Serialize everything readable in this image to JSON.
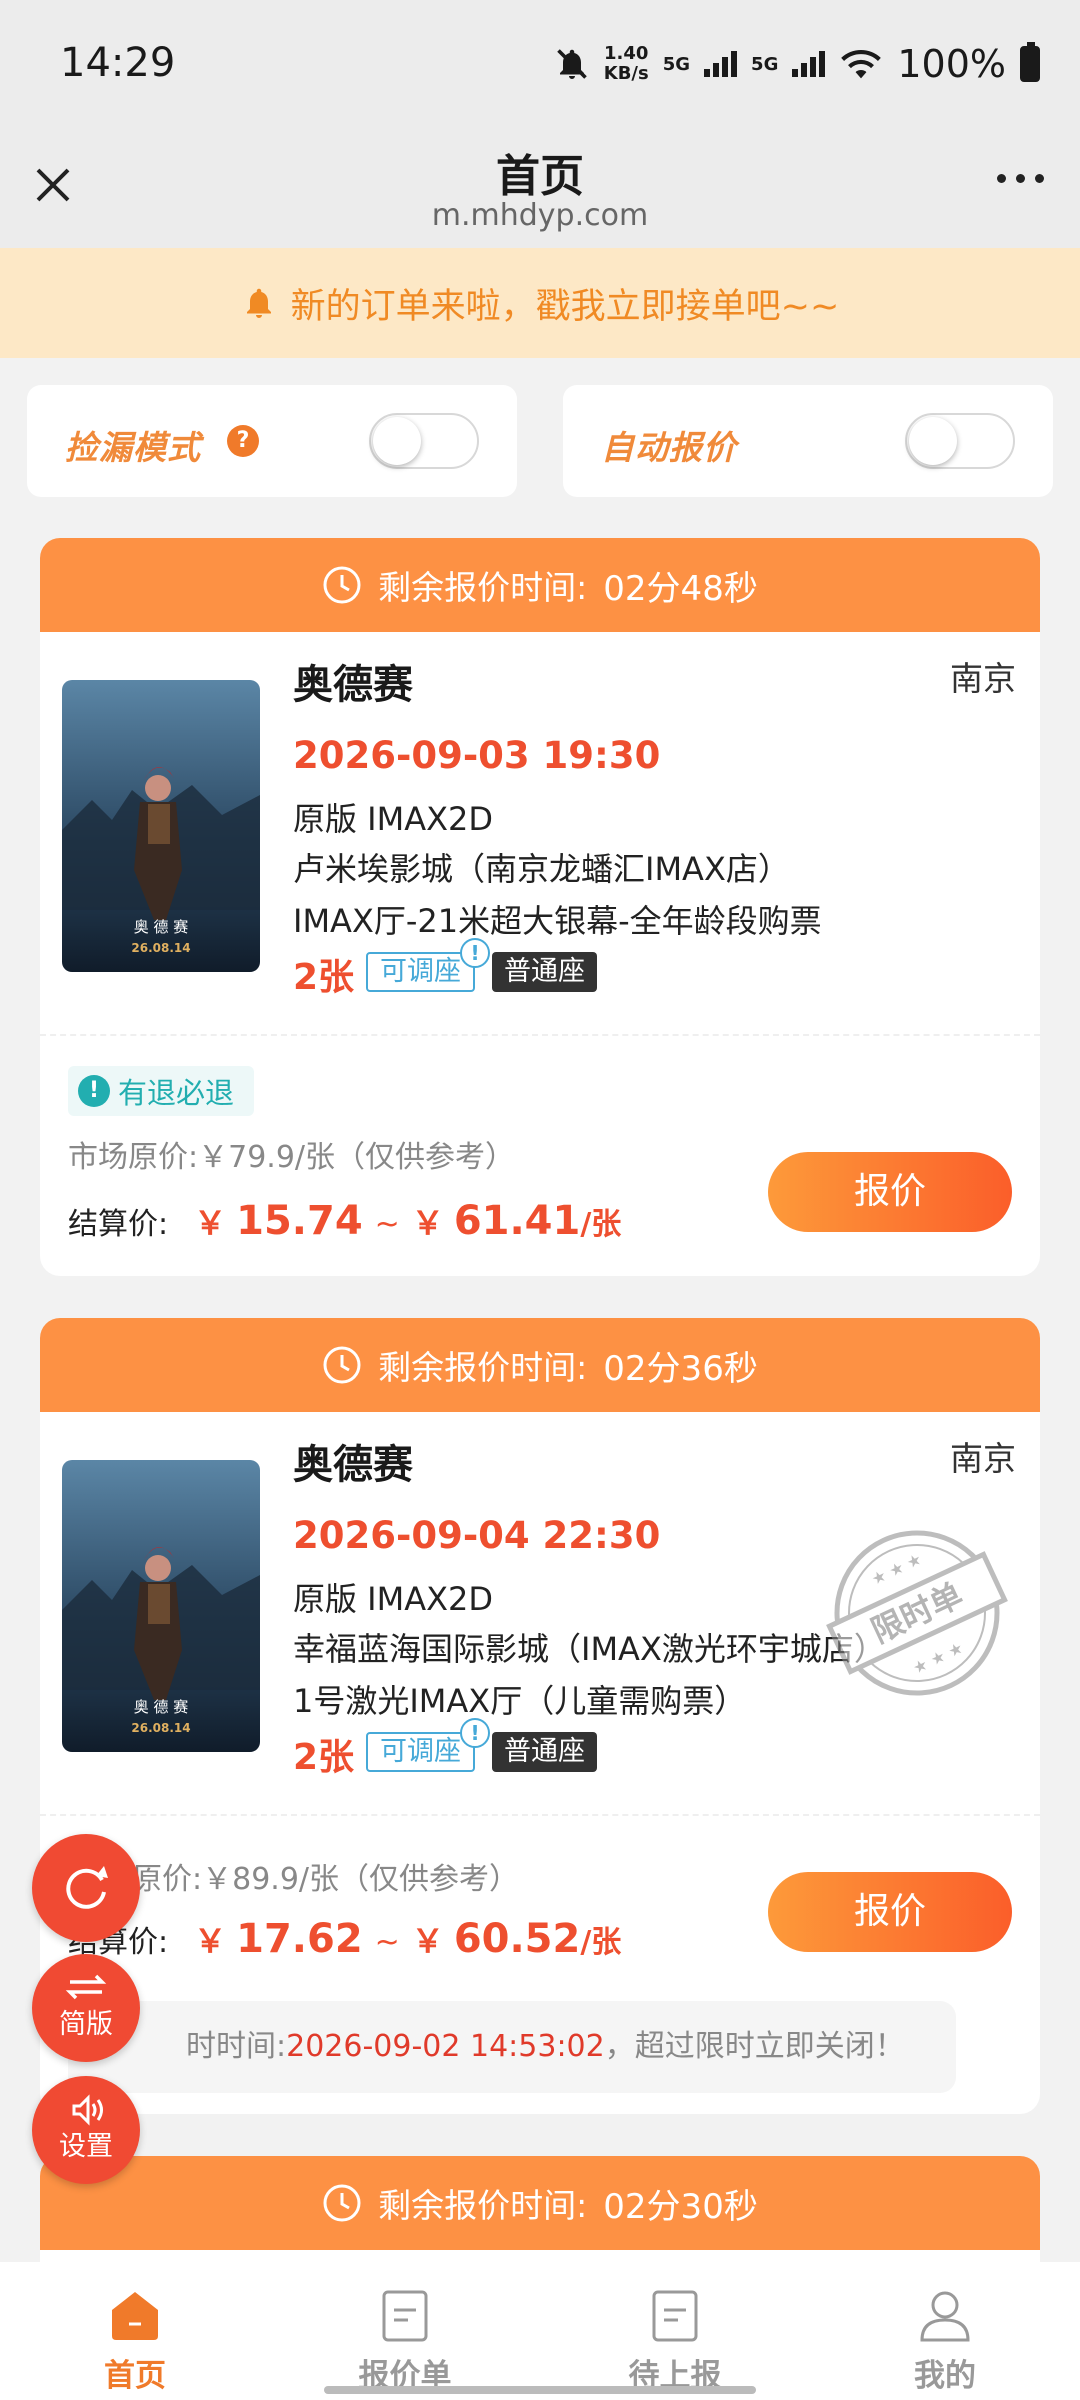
{
  "status_bar": {
    "time": "14:29",
    "net_speed_value": "1.40",
    "net_speed_unit": "KB/s",
    "signal1": "5G",
    "signal2": "5G",
    "battery": "100%"
  },
  "nav": {
    "title": "首页",
    "url": "m.mhdyp.com"
  },
  "notice": {
    "text": "新的订单来啦，戳我立即接单吧~~"
  },
  "toggles": {
    "pickup_mode_label": "捡漏模式",
    "pickup_mode_help": "?",
    "pickup_mode_on": false,
    "auto_quote_label": "自动报价",
    "auto_quote_on": false
  },
  "orders": [
    {
      "countdown_label": "剩余报价时间:",
      "countdown_value": "02分48秒",
      "title": "奥德赛",
      "city": "南京",
      "showtime": "2026-09-03 19:30",
      "version": "原版 IMAX2D",
      "cinema": "卢米埃影城（南京龙蟠汇IMAX店）",
      "hall": "IMAX厅-21米超大银幕-全年龄段购票",
      "quantity": "2张",
      "tag_adjustable": "可调座",
      "tag_seat": "普通座",
      "refund_text": "有退必退",
      "market_price": "市场原价:￥79.9/张（仅供参考）",
      "settle_label": "结算价:",
      "currency": "￥",
      "price_min": "15.74",
      "price_sep": "~",
      "price_max": "61.41",
      "price_unit": "/张",
      "quote_button": "报价"
    },
    {
      "countdown_label": "剩余报价时间:",
      "countdown_value": "02分36秒",
      "title": "奥德赛",
      "city": "南京",
      "showtime": "2026-09-04 22:30",
      "version": "原版 IMAX2D",
      "cinema": "幸福蓝海国际影城（IMAX激光环宇城店）",
      "hall": "1号激光IMAX厅（儿童需购票）",
      "quantity": "2张",
      "tag_adjustable": "可调座",
      "tag_seat": "普通座",
      "stamp_text": "限时单",
      "market_price": "原价:￥89.9/张（仅供参考）",
      "settle_label": "结算价:",
      "currency": "￥",
      "price_min": "17.62",
      "price_sep": "~",
      "price_max": "60.52",
      "price_unit": "/张",
      "quote_button": "报价",
      "deadline_label": "时时间:",
      "deadline_time": "2026-09-02 14:53:02",
      "deadline_suffix": "，超过限时立即关闭！"
    },
    {
      "countdown_label": "剩余报价时间:",
      "countdown_value": "02分30秒"
    }
  ],
  "poster_text": {
    "title": "奥 德 赛",
    "date": "26.08.14"
  },
  "fabs": {
    "simplified_label": "简版",
    "settings_label": "设置"
  },
  "bottom_nav": [
    {
      "label": "首页",
      "active": true
    },
    {
      "label": "报价单",
      "active": false
    },
    {
      "label": "待上报",
      "active": false
    },
    {
      "label": "我的",
      "active": false
    }
  ],
  "colors": {
    "accent": "#fd9144",
    "price_red": "#ee4f2f",
    "notice_bg": "#fde8c6",
    "refund_teal": "#22aeb0",
    "link_blue": "#46a9d8"
  }
}
